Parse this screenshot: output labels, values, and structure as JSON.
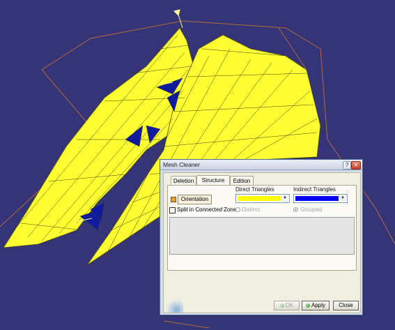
{
  "dialog": {
    "title": "Mesh Cleaner",
    "help_button": "?",
    "close_icon": "✕",
    "tabs": [
      "Deletion",
      "Structure",
      "Edition"
    ],
    "active_tab": "Structure",
    "columns": {
      "direct": "Direct Triangles",
      "indirect": "Indirect Triangles"
    },
    "orientation_button": "Orientation",
    "direct_color": "#ffff00",
    "indirect_color": "#0000ff",
    "dropdown_arrow": "▼",
    "split_label": "Split in Connected Zones",
    "distinct_label": "Distinct",
    "grouped_label": "Grouped",
    "buttons": {
      "ok": "OK",
      "apply": "Apply",
      "close": "Close"
    }
  },
  "viewport": {
    "background": "#343477",
    "mesh_color": "#ffff33",
    "inverted_color": "#101a9c",
    "guide_color": "#b66a3e"
  }
}
